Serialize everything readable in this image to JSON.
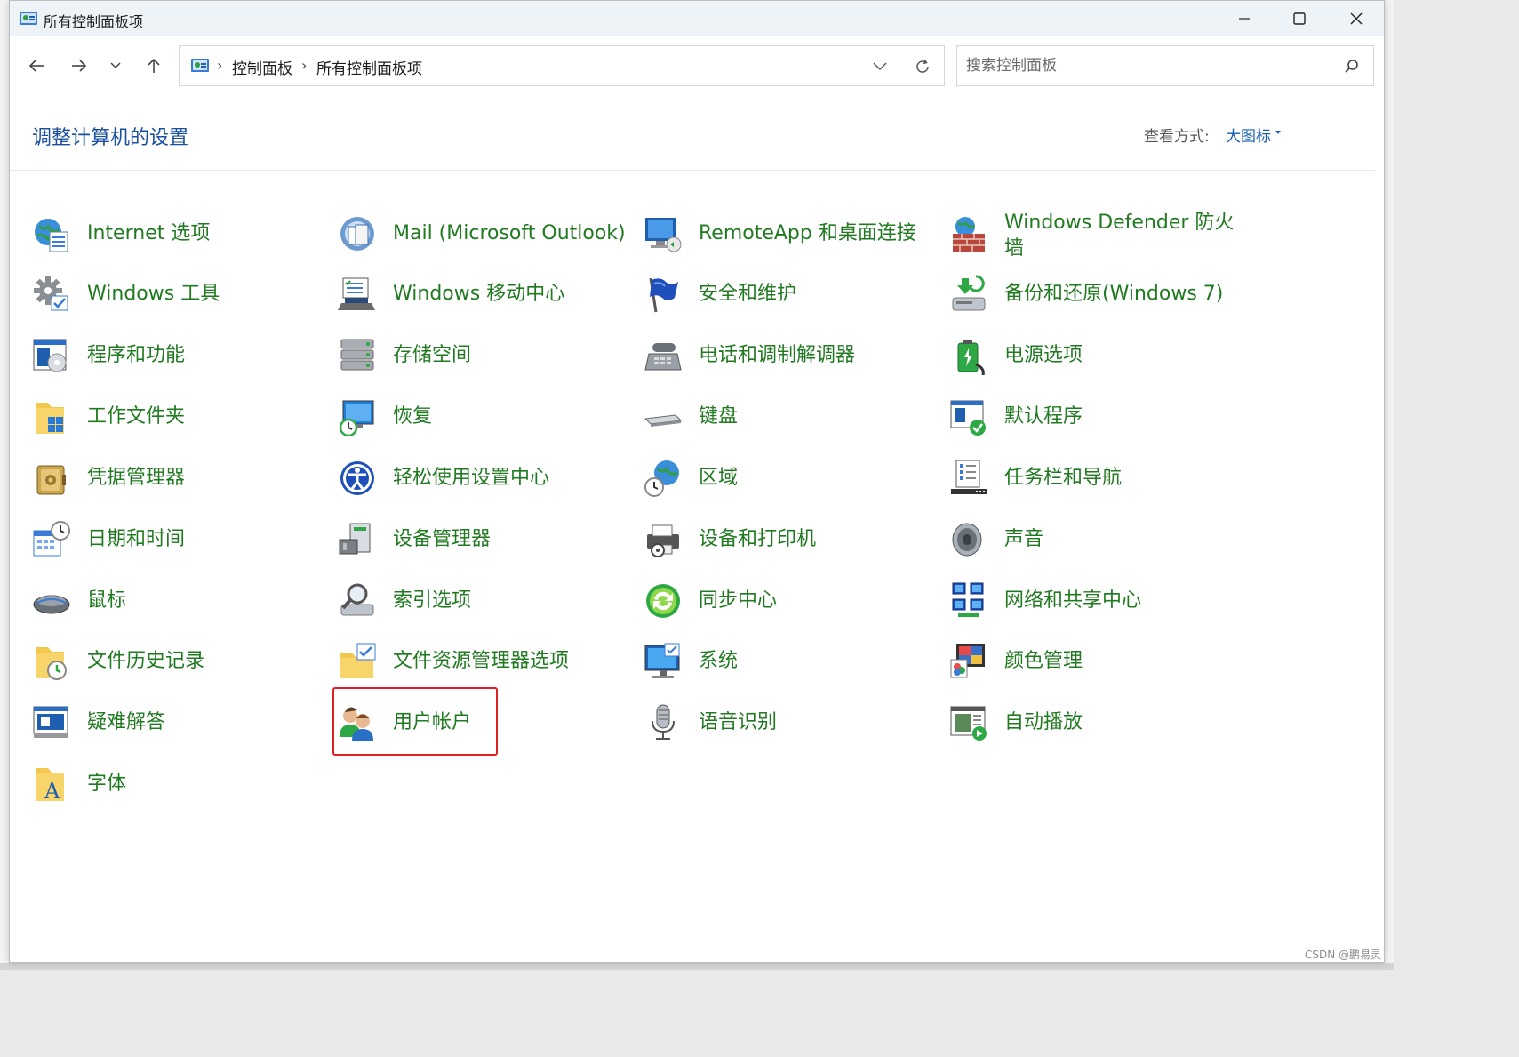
{
  "window": {
    "title": "所有控制面板项",
    "controls": {
      "minimize": "minimize",
      "maximize": "maximize",
      "close": "close"
    }
  },
  "address": {
    "crumbs": [
      "控制面板",
      "所有控制面板项"
    ],
    "search_placeholder": "搜索控制面板"
  },
  "header": {
    "heading": "调整计算机的设置",
    "view_by_label": "查看方式:",
    "view_by_value": "大图标"
  },
  "items": [
    {
      "label": "Internet 选项",
      "icon": "globe-options-icon"
    },
    {
      "label": "Mail (Microsoft Outlook)",
      "icon": "mail-icon"
    },
    {
      "label": "RemoteApp 和桌面连接",
      "icon": "remote-desktop-icon"
    },
    {
      "label": "Windows Defender 防火墙",
      "icon": "firewall-icon"
    },
    {
      "label": "Windows 工具",
      "icon": "gear-icon"
    },
    {
      "label": "Windows 移动中心",
      "icon": "mobility-center-icon"
    },
    {
      "label": "安全和维护",
      "icon": "flag-icon"
    },
    {
      "label": "备份和还原(Windows 7)",
      "icon": "backup-icon"
    },
    {
      "label": "程序和功能",
      "icon": "programs-icon"
    },
    {
      "label": "存储空间",
      "icon": "storage-icon"
    },
    {
      "label": "电话和调制解调器",
      "icon": "phone-modem-icon"
    },
    {
      "label": "电源选项",
      "icon": "power-icon"
    },
    {
      "label": "工作文件夹",
      "icon": "work-folders-icon"
    },
    {
      "label": "恢复",
      "icon": "recovery-icon"
    },
    {
      "label": "键盘",
      "icon": "keyboard-icon"
    },
    {
      "label": "默认程序",
      "icon": "default-programs-icon"
    },
    {
      "label": "凭据管理器",
      "icon": "credential-icon"
    },
    {
      "label": "轻松使用设置中心",
      "icon": "ease-of-access-icon"
    },
    {
      "label": "区域",
      "icon": "region-icon"
    },
    {
      "label": "任务栏和导航",
      "icon": "taskbar-icon"
    },
    {
      "label": "日期和时间",
      "icon": "calendar-clock-icon"
    },
    {
      "label": "设备管理器",
      "icon": "device-manager-icon"
    },
    {
      "label": "设备和打印机",
      "icon": "printer-icon"
    },
    {
      "label": "声音",
      "icon": "speaker-icon"
    },
    {
      "label": "鼠标",
      "icon": "mouse-icon"
    },
    {
      "label": "索引选项",
      "icon": "indexing-icon"
    },
    {
      "label": "同步中心",
      "icon": "sync-icon"
    },
    {
      "label": "网络和共享中心",
      "icon": "network-icon"
    },
    {
      "label": "文件历史记录",
      "icon": "file-history-icon"
    },
    {
      "label": "文件资源管理器选项",
      "icon": "folder-options-icon"
    },
    {
      "label": "系统",
      "icon": "system-monitor-icon"
    },
    {
      "label": "颜色管理",
      "icon": "color-management-icon"
    },
    {
      "label": "疑难解答",
      "icon": "troubleshoot-icon"
    },
    {
      "label": "用户帐户",
      "icon": "user-accounts-icon"
    },
    {
      "label": "语音识别",
      "icon": "microphone-icon"
    },
    {
      "label": "自动播放",
      "icon": "autoplay-icon"
    },
    {
      "label": "字体",
      "icon": "fonts-icon"
    }
  ],
  "watermark": "CSDN @鹏易灵"
}
